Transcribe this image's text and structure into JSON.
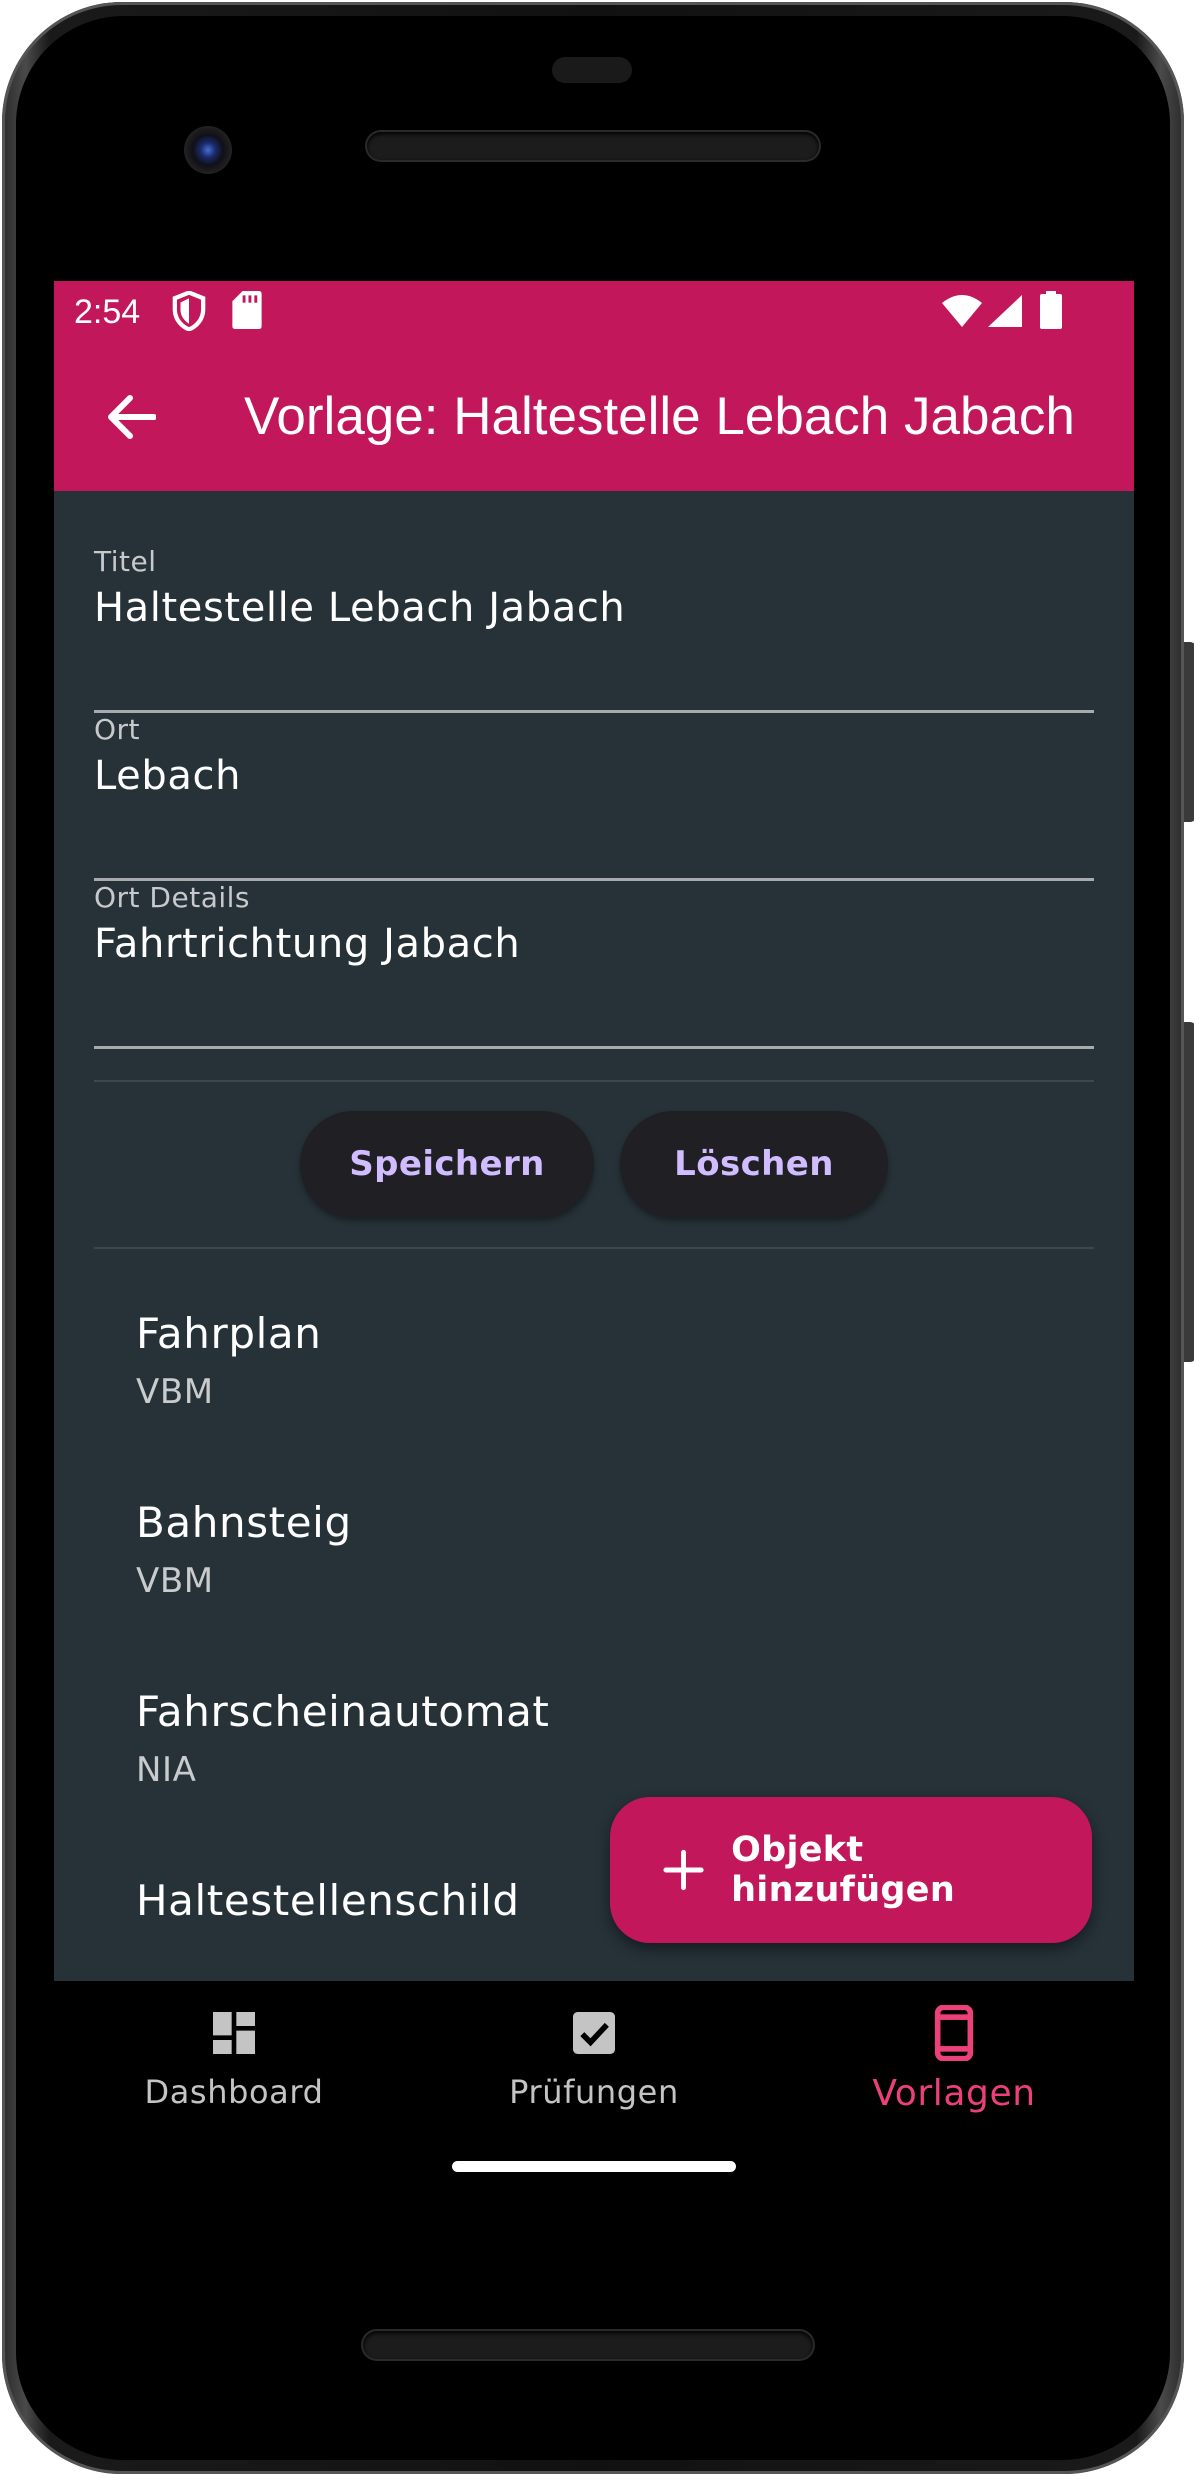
{
  "status_bar": {
    "time": "2:54"
  },
  "app_bar": {
    "title": "Vorlage: Haltestelle Lebach Jabach"
  },
  "form": {
    "fields": [
      {
        "label": "Titel",
        "value": "Haltestelle Lebach Jabach"
      },
      {
        "label": "Ort",
        "value": "Lebach"
      },
      {
        "label": "Ort Details",
        "value": "Fahrtrichtung Jabach"
      }
    ],
    "save_label": "Speichern",
    "delete_label": "Löschen"
  },
  "objects": [
    {
      "title": "Fahrplan",
      "subtitle": "VBM"
    },
    {
      "title": "Bahnsteig",
      "subtitle": "VBM"
    },
    {
      "title": "Fahrscheinautomat",
      "subtitle": "NIA"
    },
    {
      "title": "Haltestellenschild",
      "subtitle": ""
    }
  ],
  "fab": {
    "label": "Objekt hinzufügen",
    "icon": "plus-icon"
  },
  "bottom_nav": {
    "items": [
      {
        "label": "Dashboard",
        "icon": "dashboard-icon",
        "active": false
      },
      {
        "label": "Prüfungen",
        "icon": "check-box-icon",
        "active": false
      },
      {
        "label": "Vorlagen",
        "icon": "phone-template-icon",
        "active": true
      }
    ]
  },
  "colors": {
    "primary": "#c2185b",
    "surface": "#263238",
    "button_text": "#d0bcff",
    "nav_active": "#ec407a"
  }
}
